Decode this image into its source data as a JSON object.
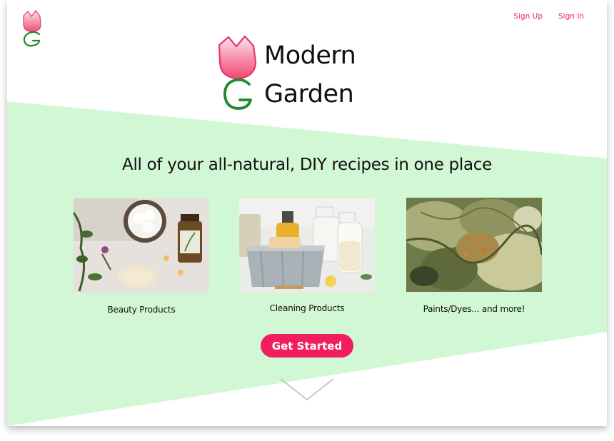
{
  "nav": {
    "sign_up": "Sign Up",
    "sign_in": "Sign In"
  },
  "brand": {
    "line1": "Modern",
    "line2": "Garden"
  },
  "hero": {
    "headline": "All of your all-natural, DIY recipes in one place",
    "cta_label": "Get Started"
  },
  "categories": [
    {
      "label": "Beauty Products",
      "image": "beauty-products-photo"
    },
    {
      "label": "Cleaning Products",
      "image": "cleaning-products-photo"
    },
    {
      "label": "Paints/Dyes... and more!",
      "image": "paints-dyes-photo"
    }
  ],
  "icons": {
    "logo": "tulip-g-logo-icon",
    "scroll": "chevron-down-icon"
  },
  "colors": {
    "accent": "#f21d61",
    "nav_link": "#e8265f",
    "band": "#d2f7d4",
    "tulip_light": "#fbdbe6",
    "tulip_dark": "#f0577f",
    "logo_green": "#1f8a2c",
    "chevron": "#bcbcbc"
  }
}
